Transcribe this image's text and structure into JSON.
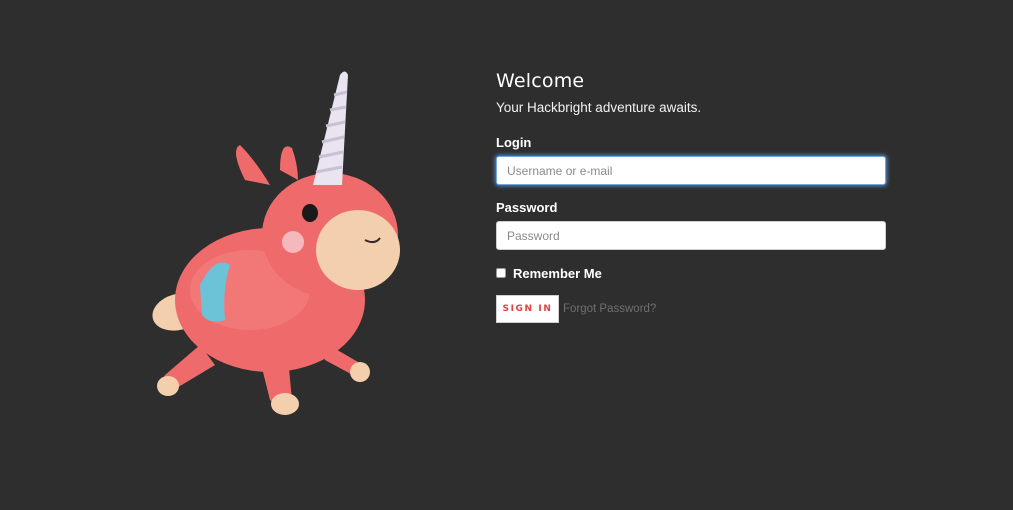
{
  "login_panel": {
    "heading": "Welcome",
    "tagline": "Your Hackbright adventure awaits.",
    "login_label": "Login",
    "login_placeholder": "Username or e-mail",
    "password_label": "Password",
    "password_placeholder": "Password",
    "remember_label": "Remember Me",
    "remember_checked": false,
    "signin_label": "SIGN IN",
    "forgot_label": "Forgot Password?"
  },
  "mascot": {
    "icon": "inflatable-unicorn-icon",
    "colors": {
      "body": "#ef6b6b",
      "muzzle": "#f4cfae",
      "patch": "#6cc3d8",
      "horn": "#e9e4ef"
    }
  },
  "colors": {
    "background": "#2e2e2e",
    "accent": "#e1403f",
    "focus_glow": "#66aaff"
  }
}
